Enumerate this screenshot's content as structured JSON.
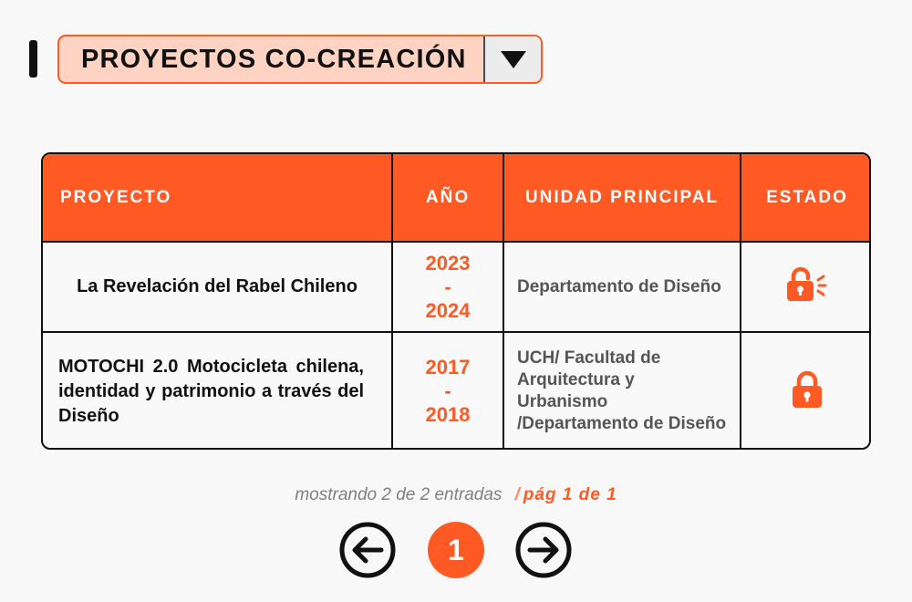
{
  "header": {
    "dropdown_label": "PROYECTOS CO-CREACIÓN",
    "dropdown_icon": "triangle-down-icon"
  },
  "table": {
    "columns": [
      "PROYECTO",
      "AÑO",
      "UNIDAD PRINCIPAL",
      "ESTADO"
    ],
    "rows": [
      {
        "project": "La Revelación del Rabel Chileno",
        "year_start": "2023",
        "year_sep": "-",
        "year_end": "2024",
        "unit": "Departamento de Diseño",
        "state_icon": "unlocked-icon"
      },
      {
        "project": "MOTOCHI 2.0 Motocicleta chilena, identidad y patrimonio a través del Diseño",
        "year_start": "2017",
        "year_sep": "-",
        "year_end": "2018",
        "unit": "UCH/ Facultad de Arquitectura y Urbanismo /Departamento de Diseño",
        "state_icon": "locked-icon"
      }
    ]
  },
  "pagination": {
    "info": "mostrando 2 de 2 entradas",
    "separator": "/",
    "page_info": "pág 1 de 1",
    "current_page": "1",
    "prev_icon": "arrow-left-circle-icon",
    "next_icon": "arrow-right-circle-icon"
  },
  "colors": {
    "accent": "#ff5a24",
    "accent_light": "#ffd3c2",
    "text": "#111111",
    "muted": "#555555"
  }
}
